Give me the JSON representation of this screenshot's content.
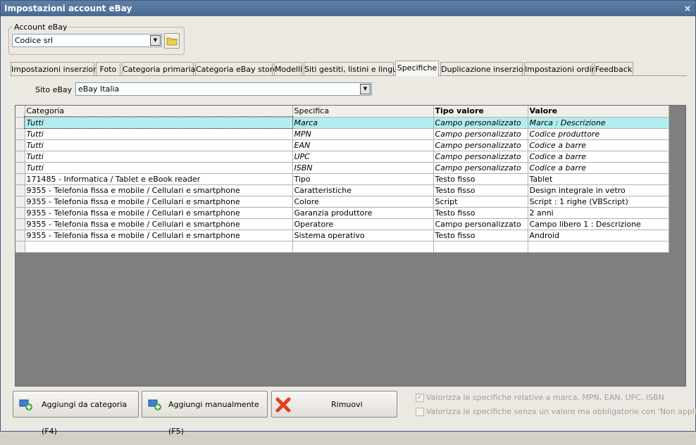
{
  "window": {
    "title": "Impostazioni account eBay",
    "close_glyph": "×"
  },
  "account": {
    "legend": "Account eBay",
    "value": "Codice srl"
  },
  "tabs": [
    "Impostazioni inserzioni",
    "Foto",
    "Categoria primaria",
    "Categoria eBay store",
    "Modelli",
    "Siti gestiti, listini e lingue",
    "Specifiche",
    "Duplicazione inserzioni",
    "Impostazioni ordini",
    "Feedback"
  ],
  "active_tab": "Specifiche",
  "site": {
    "label": "Sito eBay :",
    "value": "eBay Italia"
  },
  "grid": {
    "headers": [
      "Categoria",
      "Specifica",
      "Tipo valore",
      "Valore"
    ],
    "rows": [
      [
        "Tutti",
        "Marca",
        "Campo personalizzato",
        "Marca : Descrizione"
      ],
      [
        "Tutti",
        "MPN",
        "Campo personalizzato",
        "Codice produttore"
      ],
      [
        "Tutti",
        "EAN",
        "Campo personalizzato",
        "Codice a barre"
      ],
      [
        "Tutti",
        "UPC",
        "Campo personalizzato",
        "Codice a barre"
      ],
      [
        "Tutti",
        "ISBN",
        "Campo personalizzato",
        "Codice a barre"
      ],
      [
        "171485 - Informatica / Tablet e eBook reader",
        "Tipo",
        "Testo fisso",
        "Tablet"
      ],
      [
        "9355 - Telefonia fissa e mobile / Cellulari e smartphone",
        "Caratteristiche",
        "Testo fisso",
        "Design integrale in vetro"
      ],
      [
        "9355 - Telefonia fissa e mobile / Cellulari e smartphone",
        "Colore",
        "Script",
        "Script : 1 righe (VBScript)"
      ],
      [
        "9355 - Telefonia fissa e mobile / Cellulari e smartphone",
        "Garanzia produttore",
        "Testo fisso",
        "2 anni"
      ],
      [
        "9355 - Telefonia fissa e mobile / Cellulari e smartphone",
        "Operatore",
        "Campo personalizzato",
        "Campo libero 1 : Descrizione"
      ],
      [
        "9355 - Telefonia fissa e mobile / Cellulari e smartphone",
        "Sistema operativo",
        "Testo fisso",
        "Android"
      ]
    ],
    "selected_row": 0
  },
  "buttons": {
    "add_from_category": "Aggiungi da categoria (F4)",
    "add_manual": "Aggiungi manualmente (F5)",
    "remove": "Rimuovi"
  },
  "options": {
    "opt1": {
      "label": "Valorizza le specifiche relative a marca, MPN, EAN, UPC, ISBN",
      "checked": true
    },
    "opt2": {
      "label": "Valorizza le specifiche senza un valore ma obbligatorie con 'Non applicabile'",
      "checked": false
    }
  },
  "colors": {
    "title_bar": "#4f6f98",
    "selected_row": "#b1eeef",
    "grid_background": "#7f7f7f"
  }
}
